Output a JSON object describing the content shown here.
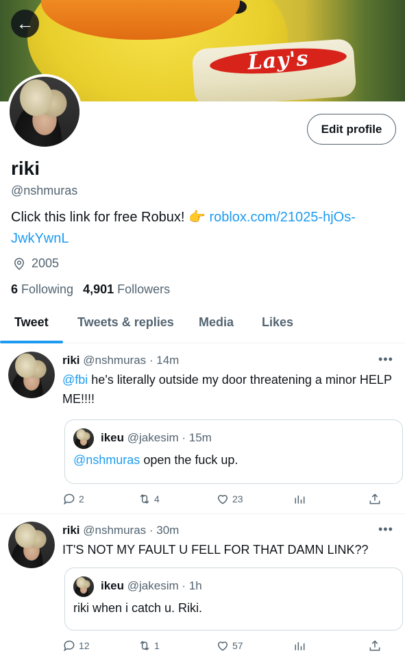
{
  "banner": {
    "chips_brand": "Lay's"
  },
  "header": {
    "back_icon": "arrow-left-icon"
  },
  "profile": {
    "name": "riki",
    "handle": "@nshmuras",
    "edit_label": "Edit profile",
    "bio_text": "Click this link for free Robux! 👉 ",
    "bio_link": "roblox.com/21025-hjOs-JwkYwnL",
    "location": "2005",
    "following_count": "6",
    "following_label": "Following",
    "followers_count": "4,901",
    "followers_label": "Followers"
  },
  "tabs": [
    {
      "label": "Tweet"
    },
    {
      "label": "Tweets & replies"
    },
    {
      "label": "Media"
    },
    {
      "label": "Likes"
    }
  ],
  "tweets": [
    {
      "name": "riki",
      "handle_time": "@nshmuras · 14m",
      "mention": "@fbi",
      "text": " he's literally outside my door threatening a minor HELP ME!!!!",
      "quote": {
        "name": "ikeu",
        "handle_time": "@jakesim · 15m",
        "mention": "@nshmuras",
        "text": " open the fuck up."
      },
      "replies": "2",
      "retweets": "4",
      "likes": "23"
    },
    {
      "name": "riki",
      "handle_time": "@nshmuras · 30m",
      "mention": "",
      "text": "IT'S NOT MY FAULT U FELL FOR THAT DAMN LINK??",
      "quote": {
        "name": "ikeu",
        "handle_time": "@jakesim · 1h",
        "mention": "",
        "text": "riki when i catch u. Riki."
      },
      "replies": "12",
      "retweets": "1",
      "likes": "57"
    }
  ],
  "more_label": "•••",
  "colors": {
    "accent": "#1d9bf0",
    "text": "#0f1419",
    "muted": "#536471"
  }
}
